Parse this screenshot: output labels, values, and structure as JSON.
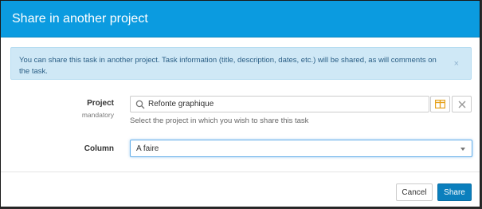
{
  "dialog": {
    "title": "Share in another project"
  },
  "alert": {
    "message": "You can share this task in another project. Task information (title, description, dates, etc.) will be shared, as will comments on the task.",
    "close_symbol": "×"
  },
  "project_field": {
    "label": "Project",
    "sublabel": "mandatory",
    "value": "Refonte graphique",
    "search_icon": "search-icon",
    "browse_icon": "folder-browse-icon",
    "clear_icon": "close-icon",
    "help": "Select the project in which you wish to share this task"
  },
  "column_field": {
    "label": "Column",
    "value": "A faire"
  },
  "footer": {
    "cancel_label": "Cancel",
    "share_label": "Share"
  },
  "colors": {
    "header": "#0b9be0",
    "alert_bg": "#cfe8f6",
    "primary_button": "#0b7fbd",
    "browse_icon": "#e6a21c"
  }
}
